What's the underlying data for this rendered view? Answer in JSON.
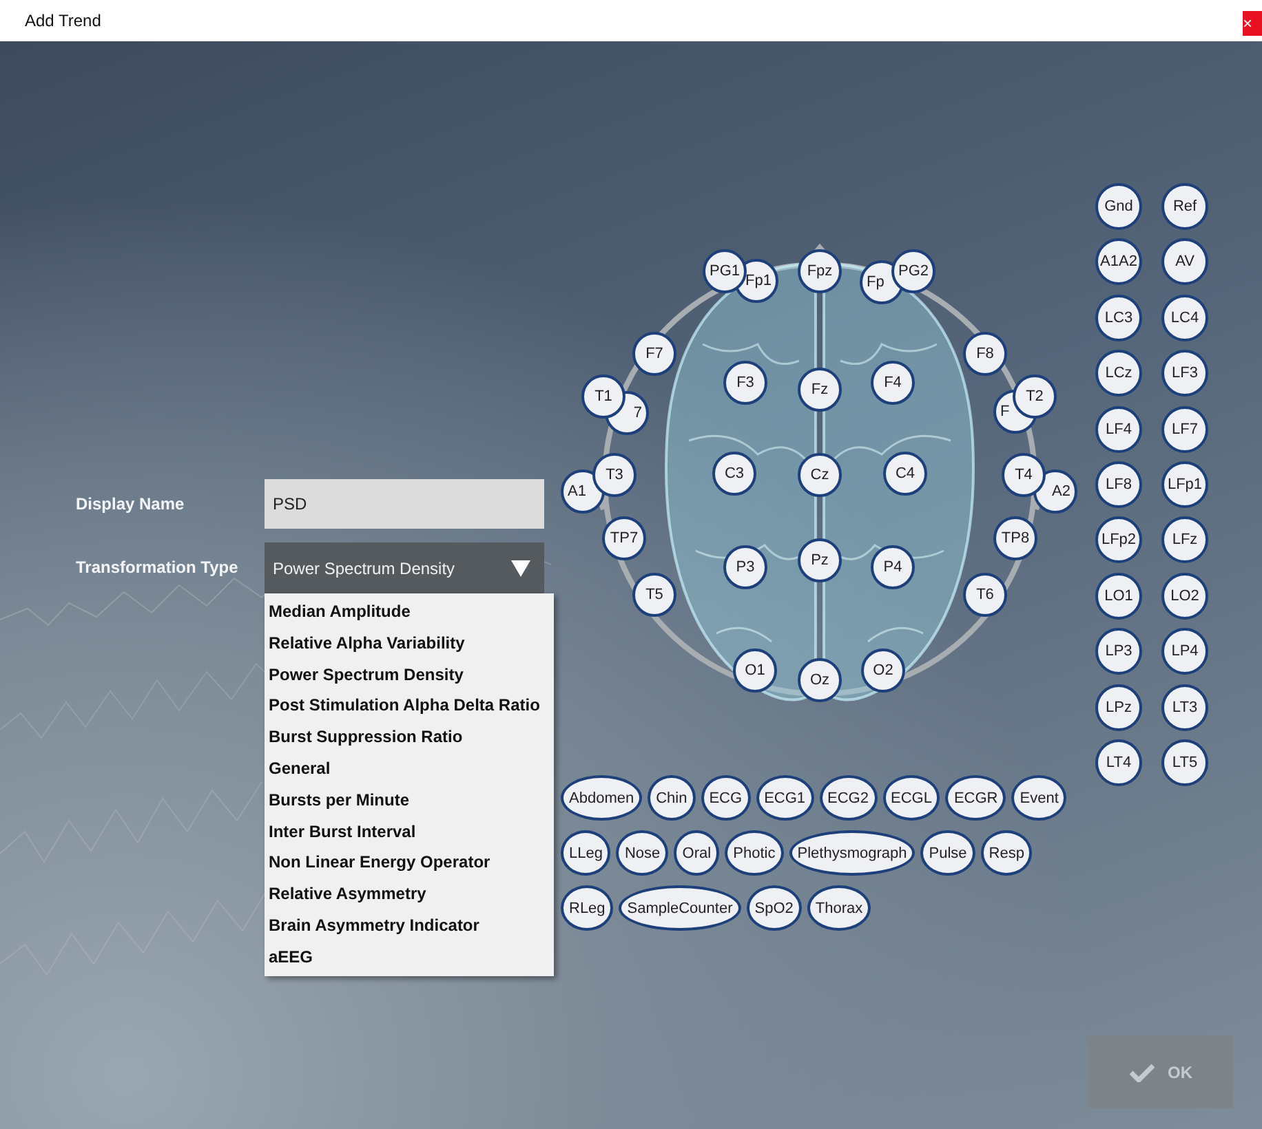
{
  "window": {
    "title": "Add Trend",
    "close": "×"
  },
  "form": {
    "display_name": {
      "label": "Display Name",
      "value": "PSD"
    },
    "transformation_type": {
      "label": "Transformation Type",
      "value": "Power Spectrum Density",
      "expanded": true,
      "options": [
        "Median Amplitude",
        "Relative Alpha Variability",
        "Power Spectrum Density",
        "Post Stimulation Alpha Delta Ratio",
        "Burst Suppression Ratio",
        "General",
        "Bursts per Minute",
        "Inter Burst Interval",
        "Non Linear Energy Operator",
        "Relative Asymmetry",
        "Brain Asymmetry Indicator",
        "aEEG"
      ]
    }
  },
  "head_electrodes": [
    "PG1",
    "Fp1",
    "Fpz",
    "Fp",
    "PG2",
    "F7",
    "F3",
    "Fz",
    "F4",
    "F8",
    "T1",
    "7",
    "F",
    "T2",
    "A1",
    "T3",
    "C3",
    "Cz",
    "C4",
    "T4",
    "A2",
    "TP7",
    "P3",
    "Pz",
    "P4",
    "TP8",
    "T5",
    "T6",
    "O1",
    "Oz",
    "O2"
  ],
  "reference_electrodes": [
    "Gnd",
    "Ref",
    "A1A2",
    "AV",
    "LC3",
    "LC4",
    "LCz",
    "LF3",
    "LF4",
    "LF7",
    "LF8",
    "LFp1",
    "LFp2",
    "LFz",
    "LO1",
    "LO2",
    "LP3",
    "LP4",
    "LPz",
    "LT3",
    "LT4",
    "LT5"
  ],
  "channels": [
    "Abdomen",
    "Chin",
    "ECG",
    "ECG1",
    "ECG2",
    "ECGL",
    "ECGR",
    "Event",
    "LLeg",
    "Nose",
    "Oral",
    "Photic",
    "Plethysmograph",
    "Pulse",
    "Resp",
    "RLeg",
    "SampleCounter",
    "SpO2",
    "Thorax"
  ],
  "ok_button": {
    "label": "OK",
    "disabled": true
  }
}
